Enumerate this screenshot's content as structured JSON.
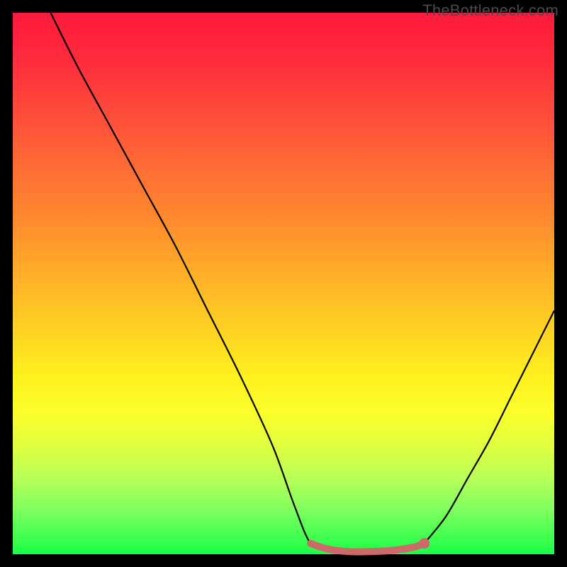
{
  "watermark": "TheBottleneck.com",
  "colors": {
    "frame": "#000000",
    "curve": "#000000",
    "marker_fill": "#cc6a6a",
    "marker_stroke": "#cc6a6a"
  },
  "chart_data": {
    "type": "line",
    "title": "",
    "xlabel": "",
    "ylabel": "",
    "xlim": [
      0,
      100
    ],
    "ylim": [
      0,
      100
    ],
    "note": "Left descending branch from (x≈7,y≈100) down to floor; right ascending branch from floor up to (x≈100,y≈45). Floor segment highlighted in salmon around x≈55–76. Values are visual estimates (percent of plot area).",
    "series": [
      {
        "name": "left-branch",
        "x": [
          7,
          12,
          18,
          24,
          30,
          36,
          42,
          48,
          52,
          55
        ],
        "y": [
          100,
          90,
          79,
          68,
          57,
          45,
          33,
          20,
          9,
          2
        ]
      },
      {
        "name": "floor",
        "x": [
          55,
          58,
          62,
          66,
          70,
          74,
          76
        ],
        "y": [
          2,
          1,
          0.5,
          0.5,
          0.7,
          1.3,
          2
        ]
      },
      {
        "name": "right-branch",
        "x": [
          76,
          80,
          84,
          88,
          92,
          96,
          100
        ],
        "y": [
          2,
          7,
          14,
          21,
          29,
          37,
          45
        ]
      }
    ],
    "highlight": {
      "name": "floor-range",
      "x_start": 55,
      "x_end": 76,
      "color": "#cc6a6a"
    },
    "marker": {
      "x": 76,
      "y": 2,
      "r": 1.0
    }
  }
}
